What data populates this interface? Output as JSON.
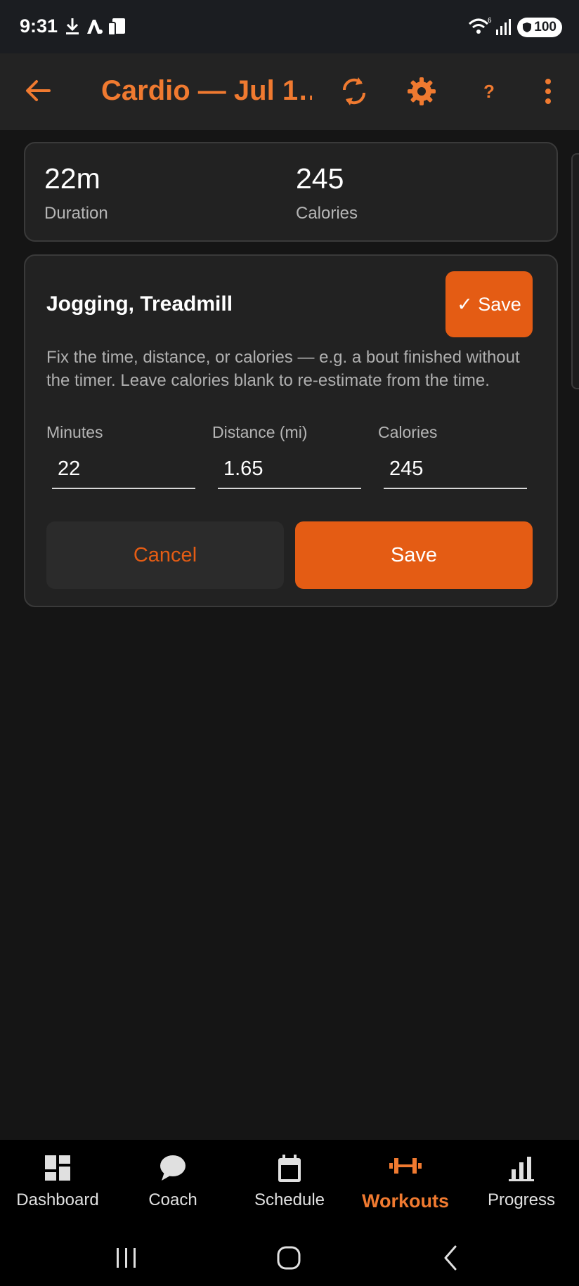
{
  "status_bar": {
    "time": "9:31",
    "battery": "100"
  },
  "app_bar": {
    "title": "Cardio — Jul 1…",
    "help_label": "?"
  },
  "summary": {
    "duration_value": "22m",
    "duration_label": "Duration",
    "calories_value": "245",
    "calories_label": "Calories"
  },
  "editor": {
    "exercise_name": "Jogging, Treadmill",
    "save_chip_label": "✓ Save",
    "help_text": "Fix the time, distance, or calories — e.g. a bout finished without the timer. Leave calories blank to re-estimate from the time.",
    "fields": [
      {
        "label": "Minutes",
        "value": "22"
      },
      {
        "label": "Distance (mi)",
        "value": "1.65"
      },
      {
        "label": "Calories",
        "value": "245"
      }
    ],
    "cancel_label": "Cancel",
    "save_label": "Save"
  },
  "bottom_nav": {
    "items": [
      {
        "label": "Dashboard",
        "icon": "dashboard-icon"
      },
      {
        "label": "Coach",
        "icon": "chat-bubble-icon"
      },
      {
        "label": "Schedule",
        "icon": "calendar-icon"
      },
      {
        "label": "Workouts",
        "icon": "dumbbell-icon",
        "active": true
      },
      {
        "label": "Progress",
        "icon": "bar-chart-icon"
      }
    ]
  },
  "colors": {
    "accent": "#e45c14",
    "accent_text": "#f07a30",
    "background": "#151515",
    "card": "#222222"
  }
}
